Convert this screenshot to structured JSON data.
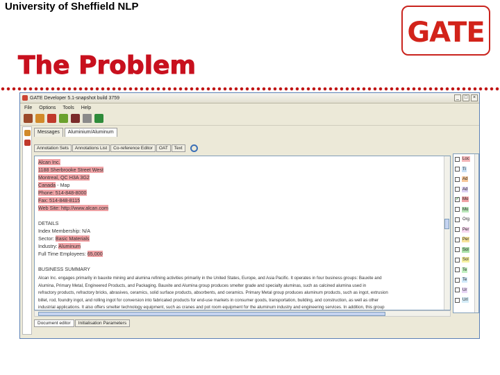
{
  "slide": {
    "header": "University of Sheffield NLP",
    "logo": "GATE",
    "title": "The Problem"
  },
  "window": {
    "title": "GATE Developer 5.1-snapshot build 3759",
    "menu": [
      "File",
      "Options",
      "Tools",
      "Help"
    ],
    "tabs": [
      "Messages",
      "Aluminium/Aluminum"
    ],
    "view_tabs": [
      "Annotation Sets",
      "Annotations List",
      "Co-reference Editor",
      "OAT",
      "Text"
    ],
    "bottom_tabs": [
      "Document editor",
      "Initialisation Parameters"
    ],
    "colors": {
      "highlight": "#f0a3a6",
      "accent": "#5a7fb5"
    }
  },
  "document": {
    "lines": [
      {
        "pre": "",
        "hl": "Alcan Inc.",
        "post": ""
      },
      {
        "pre": "",
        "hl": "1188 Sherbrooke Street West",
        "post": ""
      },
      {
        "pre": "",
        "hl": "Montreal, QC H3A 3G2",
        "post": ""
      },
      {
        "pre": "",
        "hl": "Canada",
        "post": " - Map"
      },
      {
        "pre": "",
        "hl": "Phone: 514-848-8000",
        "post": ""
      },
      {
        "pre": "",
        "hl": "Fax: 514-848-8115",
        "post": ""
      },
      {
        "pre": "",
        "hl": "Web Site: http://www.alcan.com",
        "post": ""
      },
      {
        "pre": "",
        "hl": "",
        "post": ""
      },
      {
        "pre": "DETAILS",
        "hl": "",
        "post": ""
      },
      {
        "pre": "Index Membership: N/A",
        "hl": "",
        "post": ""
      },
      {
        "pre": "Sector: ",
        "hl": "Basic Materials",
        "post": ""
      },
      {
        "pre": "Industry: ",
        "hl": "Aluminum",
        "post": ""
      },
      {
        "pre": "Full Time Employees: ",
        "hl": "65,000",
        "post": ""
      },
      {
        "pre": "",
        "hl": "",
        "post": ""
      },
      {
        "pre": "BUSINESS SUMMARY",
        "hl": "",
        "post": ""
      }
    ],
    "summary": [
      "Alcan Inc. engages primarily in bauxite mining and alumina refining activities primarily in the United States, Europe, and Asia Pacific. It operates in four business groups: Bauxite and",
      "Alumina, Primary Metal, Engineered Products, and Packaging. Bauxite and Alumina group produces smelter grade and specialty aluminas, such as calcined alumina used in",
      "refractory products, refractory bricks, abrasives, ceramics, solid surface products, absorbents, and ceramics. Primary Metal group produces aluminum products, such as ingot, extrusion",
      "billet, rod, foundry ingot, and rolling ingot for conversion into fabricated products for end-use markets in consumer goods, transportation, building, and construction, as well as other",
      "industrial applications. It also offers smelter technology equipment, such as cranes and pot room equipment for the aluminum industry and engineering services. In addition, this group"
    ]
  },
  "types": [
    {
      "label": "Loc",
      "checked": false,
      "color": "#f4b6b8"
    },
    {
      "label": "Ti",
      "checked": false,
      "color": "#c8e0f4"
    },
    {
      "label": "Ad",
      "checked": false,
      "color": "#f6c89a"
    },
    {
      "label": "Ad",
      "checked": false,
      "color": "#dcd0f2"
    },
    {
      "label": "Mo",
      "checked": true,
      "color": "#f0a3a6"
    },
    {
      "label": "Mo",
      "checked": false,
      "color": "#b8e6b8"
    },
    {
      "label": "Org",
      "checked": false,
      "color": "#ffffff"
    },
    {
      "label": "Per",
      "checked": false,
      "color": "#f7d8ef"
    },
    {
      "label": "Per",
      "checked": false,
      "color": "#f6e39a"
    },
    {
      "label": "Sol",
      "checked": false,
      "color": "#a8e0a8"
    },
    {
      "label": "Sol",
      "checked": false,
      "color": "#f5f0a0"
    },
    {
      "label": "Te",
      "checked": false,
      "color": "#c0f0c0"
    },
    {
      "label": "Te",
      "checked": false,
      "color": "#cfe8f9"
    },
    {
      "label": "Ur",
      "checked": false,
      "color": "#e8d6f6"
    },
    {
      "label": "Url",
      "checked": false,
      "color": "#d4ecf7"
    }
  ]
}
